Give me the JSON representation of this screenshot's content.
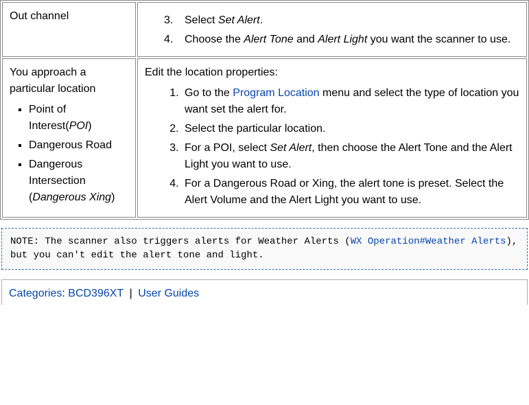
{
  "table": {
    "row1": {
      "left": "Out channel",
      "right": {
        "item3_a": "Select ",
        "item3_b": "Set Alert",
        "item3_c": ".",
        "item4_a": "Choose the ",
        "item4_b": "Alert Tone",
        "item4_c": " and ",
        "item4_d": "Alert Light",
        "item4_e": " you want the scanner to use."
      }
    },
    "row2": {
      "left": {
        "heading": "You approach a particular location",
        "bullet1_a": "Point of Interest(",
        "bullet1_b": "POI",
        "bullet1_c": ")",
        "bullet2": "Dangerous Road",
        "bullet3_a": "Dangerous Intersection (",
        "bullet3_b": "Dangerous Xing",
        "bullet3_c": ")"
      },
      "right": {
        "heading": "Edit the location properties:",
        "item1_a": "Go to the ",
        "item1_link": "Program Location",
        "item1_b": " menu and select the type of location you want set the alert for.",
        "item2": "Select the particular location.",
        "item3_a": "For a POI, select ",
        "item3_b": "Set Alert",
        "item3_c": ", then choose the Alert Tone and the Alert Light you want to use.",
        "item4": "For a Dangerous Road or Xing, the alert tone is preset. Select the Alert Volume and the Alert Light you want to use."
      }
    }
  },
  "note": {
    "line1_a": "NOTE: The scanner also triggers alerts for Weather Alerts (",
    "line1_link": "WX Operation#Weather Alerts",
    "line1_b": "),",
    "line2": "but you can't edit the alert tone and light."
  },
  "categories": {
    "label": "Categories",
    "colon": ": ",
    "cat1": "BCD396XT",
    "sep": " | ",
    "cat2": "User Guides"
  }
}
